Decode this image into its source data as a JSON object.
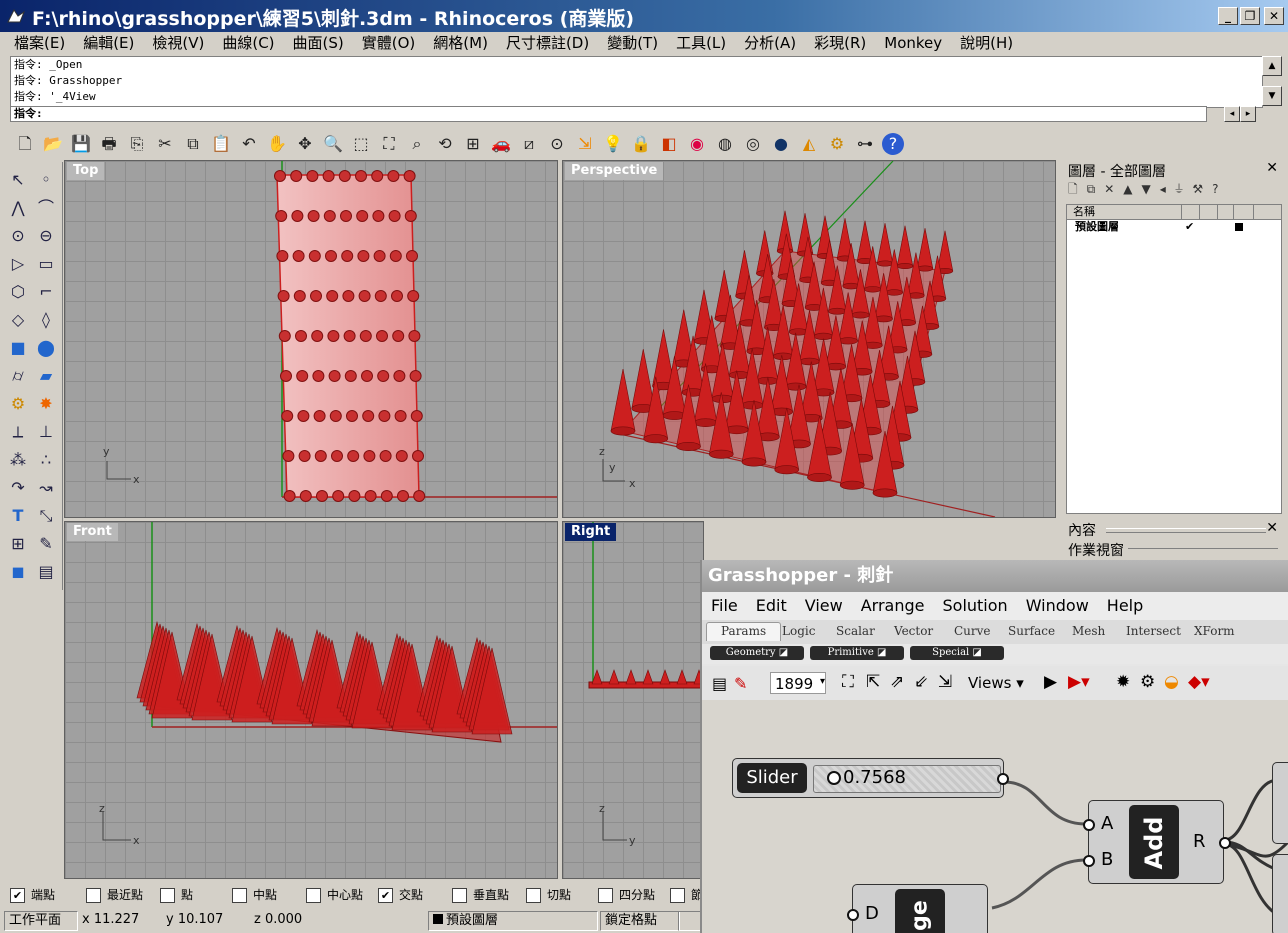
{
  "window": {
    "title": "F:\\rhino\\grasshopper\\練習5\\刺針.3dm - Rhinoceros (商業版)"
  },
  "menu": [
    "檔案(E)",
    "編輯(E)",
    "檢視(V)",
    "曲線(C)",
    "曲面(S)",
    "實體(O)",
    "網格(M)",
    "尺寸標註(D)",
    "變動(T)",
    "工具(L)",
    "分析(A)",
    "彩現(R)",
    "Monkey",
    "說明(H)"
  ],
  "command": {
    "history": [
      "指令: _Open",
      "指令: Grasshopper",
      "指令: '_4View"
    ],
    "prompt": "指令:"
  },
  "viewports": {
    "top": "Top",
    "perspective": "Perspective",
    "front": "Front",
    "right": "Right"
  },
  "axes": {
    "x": "x",
    "y": "y",
    "z": "z"
  },
  "layer_panel": {
    "title": "圖層 - 全部圖層",
    "col_name": "名稱",
    "layer_name": "預設圖層",
    "layer_check": "✔",
    "layer_color": "#000000"
  },
  "props_panel": {
    "title": "內容",
    "subtitle": "作業視窗"
  },
  "osnaps": [
    {
      "label": "端點",
      "checked": true
    },
    {
      "label": "最近點",
      "checked": false
    },
    {
      "label": "點",
      "checked": false
    },
    {
      "label": "中點",
      "checked": false
    },
    {
      "label": "中心點",
      "checked": false
    },
    {
      "label": "交點",
      "checked": true
    },
    {
      "label": "垂直點",
      "checked": false
    },
    {
      "label": "切點",
      "checked": false
    },
    {
      "label": "四分點",
      "checked": false
    },
    {
      "label": "節",
      "checked": false
    }
  ],
  "status": {
    "cplane": "工作平面",
    "x": "x 11.227",
    "y": "y 10.107",
    "z": "z 0.000",
    "layer": "預設圖層",
    "grid_snap": "鎖定格點"
  },
  "grasshopper": {
    "title": "Grasshopper - 刺針",
    "menu": [
      "File",
      "Edit",
      "View",
      "Arrange",
      "Solution",
      "Window",
      "Help"
    ],
    "tabs": [
      "Params",
      "Logic",
      "Scalar",
      "Vector",
      "Curve",
      "Surface",
      "Mesh",
      "Intersect",
      "XForm"
    ],
    "subpanels": [
      "Geometry",
      "Primitive",
      "Special"
    ],
    "zoom": "1899",
    "views_label": "Views",
    "slider": {
      "label": "Slider",
      "value": "0.7568"
    },
    "add": {
      "name": "Add",
      "in_a": "A",
      "in_b": "B",
      "out": "R"
    },
    "other": {
      "input": "D",
      "name": "ge"
    }
  },
  "colors": {
    "accent": "#0a246a",
    "object_red": "#cc1f1f"
  }
}
